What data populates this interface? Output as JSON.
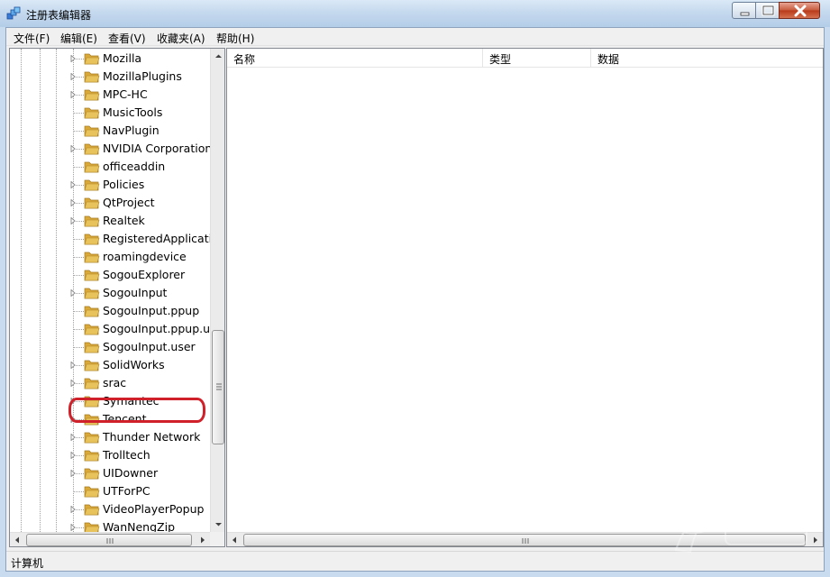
{
  "window": {
    "title": "注册表编辑器",
    "icon": "regedit-icon"
  },
  "menubar": {
    "items": [
      "文件(F)",
      "编辑(E)",
      "查看(V)",
      "收藏夹(A)",
      "帮助(H)"
    ]
  },
  "tree": {
    "items": [
      {
        "label": "Mozilla",
        "expandable": true
      },
      {
        "label": "MozillaPlugins",
        "expandable": true
      },
      {
        "label": "MPC-HC",
        "expandable": true
      },
      {
        "label": "MusicTools",
        "expandable": false
      },
      {
        "label": "NavPlugin",
        "expandable": false
      },
      {
        "label": "NVIDIA Corporation",
        "expandable": true
      },
      {
        "label": "officeaddin",
        "expandable": false
      },
      {
        "label": "Policies",
        "expandable": true
      },
      {
        "label": "QtProject",
        "expandable": true
      },
      {
        "label": "Realtek",
        "expandable": true
      },
      {
        "label": "RegisteredApplications",
        "expandable": false
      },
      {
        "label": "roamingdevice",
        "expandable": false
      },
      {
        "label": "SogouExplorer",
        "expandable": false
      },
      {
        "label": "SogouInput",
        "expandable": true
      },
      {
        "label": "SogouInput.ppup",
        "expandable": false
      },
      {
        "label": "SogouInput.ppup.user",
        "expandable": false
      },
      {
        "label": "SogouInput.user",
        "expandable": false
      },
      {
        "label": "SolidWorks",
        "expandable": true,
        "highlighted": true
      },
      {
        "label": "srac",
        "expandable": true
      },
      {
        "label": "Symantec",
        "expandable": true
      },
      {
        "label": "Tencent",
        "expandable": true
      },
      {
        "label": "Thunder Network",
        "expandable": true
      },
      {
        "label": "Trolltech",
        "expandable": true
      },
      {
        "label": "UIDowner",
        "expandable": true
      },
      {
        "label": "UTForPC",
        "expandable": false
      },
      {
        "label": "VideoPlayerPopup",
        "expandable": true
      },
      {
        "label": "WanNengZip",
        "expandable": true
      }
    ]
  },
  "list": {
    "columns": [
      "名称",
      "类型",
      "数据"
    ]
  },
  "statusbar": {
    "path": "计算机"
  },
  "colors": {
    "highlight": "#d0202a",
    "folder": "#e8c25a"
  }
}
